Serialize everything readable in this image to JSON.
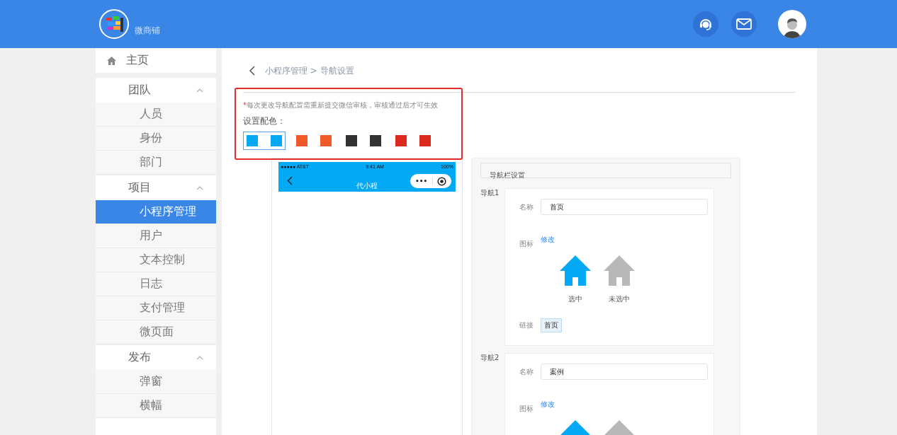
{
  "header": {
    "brand": "微商铺"
  },
  "sidebar": {
    "home": "主页",
    "groups": [
      {
        "label": "团队",
        "expanded": true,
        "children": [
          {
            "label": "人员",
            "selected": false
          },
          {
            "label": "身份",
            "selected": false
          },
          {
            "label": "部门",
            "selected": false
          }
        ]
      },
      {
        "label": "项目",
        "expanded": true,
        "children": [
          {
            "label": "小程序管理",
            "selected": true
          },
          {
            "label": "用户",
            "selected": false
          },
          {
            "label": "文本控制",
            "selected": false
          },
          {
            "label": "日志",
            "selected": false
          },
          {
            "label": "支付管理",
            "selected": false
          },
          {
            "label": "微页面",
            "selected": false
          }
        ]
      },
      {
        "label": "发布",
        "expanded": true,
        "children": [
          {
            "label": "弹窗",
            "selected": false
          },
          {
            "label": "横幅",
            "selected": false
          }
        ]
      }
    ]
  },
  "breadcrumb": "小程序管理 > 导航设置",
  "notice": {
    "mark": "*",
    "text": "每次更改导航配置需重新提交微信审核，审核通过后才可生效"
  },
  "palette": {
    "label": "设置配色：",
    "swatches": [
      {
        "color": "#03a9f4",
        "selected": true
      },
      {
        "color": "#f05a28",
        "selected": false
      },
      {
        "color": "#333333",
        "selected": false
      },
      {
        "color": "#dd2a1f",
        "selected": false
      }
    ]
  },
  "phone": {
    "carrier": "●●●●● AT&T",
    "time": "9:41 AM",
    "battery": "100%",
    "title": "代小程",
    "menu_button": "•••"
  },
  "nav_settings": {
    "title": "导航栏设置",
    "navs": [
      {
        "label": "导航1",
        "name_label": "名称",
        "name": "首页",
        "icon_label": "图标",
        "edit_link": "修改",
        "selected_caption": "选中",
        "unselected_caption": "未选中",
        "link_label": "链接",
        "link": "首页"
      },
      {
        "label": "导航2",
        "name_label": "名称",
        "name": "案例",
        "icon_label": "图标",
        "edit_link": "修改"
      }
    ]
  }
}
